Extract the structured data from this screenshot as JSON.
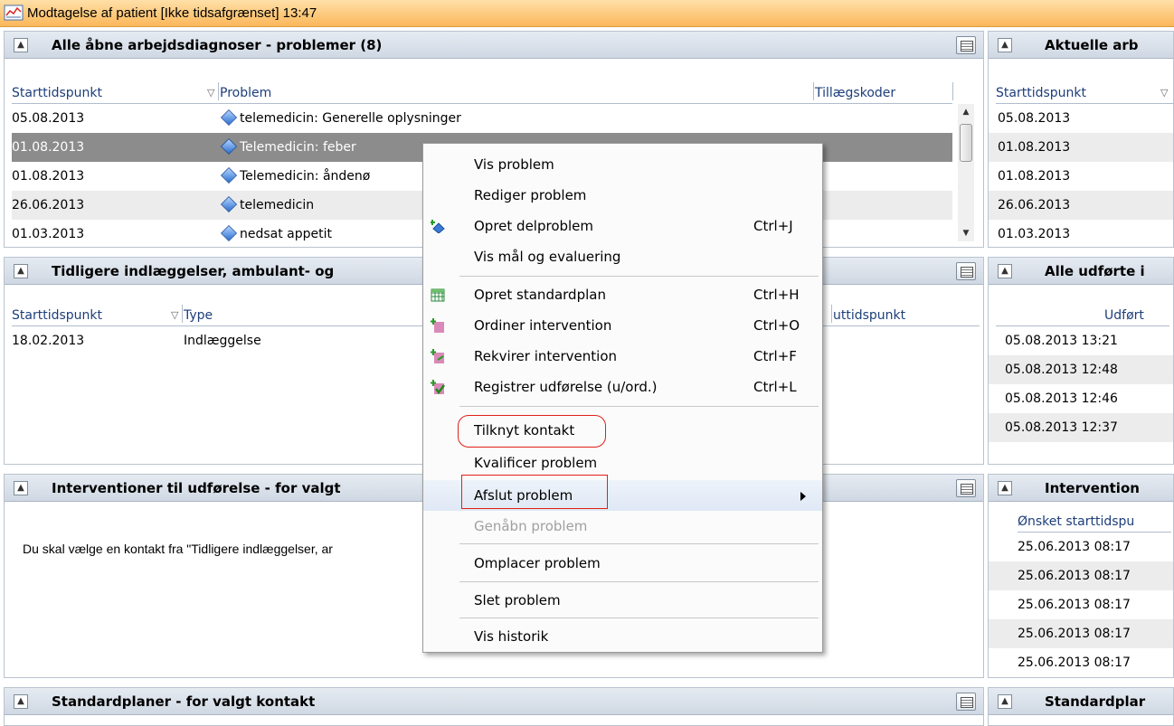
{
  "window": {
    "title": "Modtagelse af patient [Ikke tidsafgrænset] 13:47"
  },
  "panel_problems": {
    "title": "Alle åbne arbejdsdiagnoser - problemer (8)",
    "columns": [
      "Starttidspunkt",
      "Problem",
      "Tillægskoder"
    ],
    "rows": [
      {
        "date": "05.08.2013",
        "problem": "telemedicin: Generelle oplysninger"
      },
      {
        "date": "01.08.2013",
        "problem": "Telemedicin: feber"
      },
      {
        "date": "01.08.2013",
        "problem": "Telemedicin: åndenø"
      },
      {
        "date": "26.06.2013",
        "problem": "telemedicin"
      },
      {
        "date": "01.03.2013",
        "problem": "nedsat appetit"
      }
    ]
  },
  "panel_current": {
    "title": "Aktuelle arb",
    "column": "Starttidspunkt",
    "rows": [
      "05.08.2013",
      "01.08.2013",
      "01.08.2013",
      "26.06.2013",
      "01.03.2013"
    ]
  },
  "panel_admissions": {
    "title": "Tidligere indlæggelser, ambulant- og",
    "columns": [
      "Starttidspunkt",
      "Type",
      "uttidspunkt"
    ],
    "rows": [
      {
        "date": "18.02.2013",
        "type": "Indlæggelse"
      }
    ]
  },
  "panel_performed": {
    "title": "Alle udførte i",
    "column": "Udført",
    "rows": [
      "05.08.2013 13:21",
      "05.08.2013 12:48",
      "05.08.2013 12:46",
      "05.08.2013 12:37"
    ]
  },
  "panel_interventions": {
    "title": "Interventioner til udførelse - for valgt",
    "message": "Du skal vælge en kontakt fra \"Tidligere indlæggelser, ar"
  },
  "panel_interventions_right": {
    "title": "Intervention",
    "column": "Ønsket starttidspu",
    "rows": [
      "25.06.2013 08:17",
      "25.06.2013 08:17",
      "25.06.2013 08:17",
      "25.06.2013 08:17",
      "25.06.2013 08:17"
    ]
  },
  "panel_standardplans": {
    "title": "Standardplaner - for valgt kontakt"
  },
  "panel_standardplans_right": {
    "title": "Standardplar"
  },
  "context_menu": {
    "items": [
      {
        "label": "Vis problem",
        "shortcut": ""
      },
      {
        "label": "Rediger problem",
        "shortcut": ""
      },
      {
        "label": "Opret delproblem",
        "shortcut": "Ctrl+J"
      },
      {
        "label": "Vis mål og evaluering",
        "shortcut": ""
      },
      {
        "label": "Opret standardplan",
        "shortcut": "Ctrl+H"
      },
      {
        "label": "Ordiner intervention",
        "shortcut": "Ctrl+O"
      },
      {
        "label": "Rekvirer intervention",
        "shortcut": "Ctrl+F"
      },
      {
        "label": "Registrer udførelse (u/ord.)",
        "shortcut": "Ctrl+L"
      },
      {
        "label": "Tilknyt kontakt",
        "shortcut": ""
      },
      {
        "label": "Kvalificer problem",
        "shortcut": ""
      },
      {
        "label": "Afslut problem",
        "shortcut": ""
      },
      {
        "label": "Genåbn problem",
        "shortcut": ""
      },
      {
        "label": "Omplacer problem",
        "shortcut": ""
      },
      {
        "label": "Slet problem",
        "shortcut": ""
      },
      {
        "label": "Vis historik",
        "shortcut": ""
      }
    ]
  },
  "colors": {
    "titlebar": "#fbb75a",
    "selected_row": "#8c8c8c",
    "annotation": "#e0201a"
  }
}
